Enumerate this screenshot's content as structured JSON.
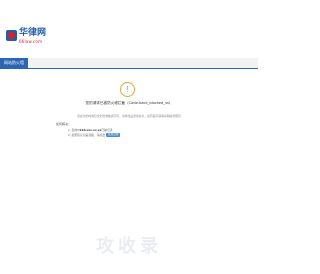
{
  "header": {
    "logo_text": "华律网",
    "logo_sub": "66law.com"
  },
  "nav": {
    "tab_label": "网站防火墙"
  },
  "panel": {
    "warning_glyph": "!",
    "blocked_title": "您的请求已被防火墙拦截（Code:back_blocked_ss）",
    "notice": "您提交的内容包含危险或敏感字符，请修改后重新提交，如有疑问请联系网站管理员",
    "hint_title": "如何解决：",
    "hints": [
      {
        "prefix": "1. 您的IP",
        "strong": "220.xxx.xx.xx",
        "suffix": "已被记录"
      },
      {
        "prefix": "2. 如果您认为",
        "strong": "",
        "suffix": "是误报，请点击"
      }
    ],
    "retry_label": "反馈误报"
  },
  "watermark": {
    "text": "攻收录"
  },
  "colors": {
    "brand_blue": "#2a66b3",
    "warning_orange": "#e8a53b",
    "logo_red": "#d8232a"
  }
}
